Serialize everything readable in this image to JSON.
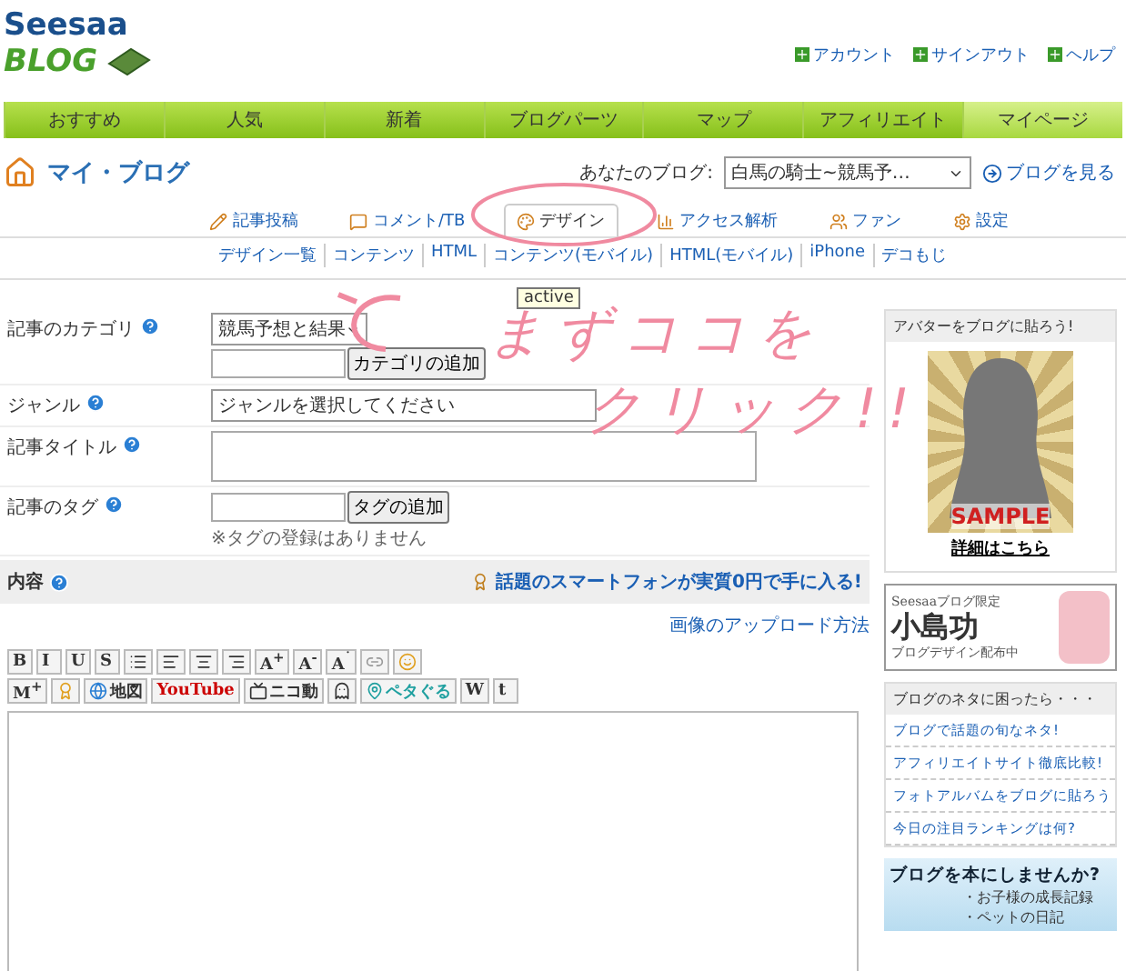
{
  "logo": {
    "line1": "Seesaa",
    "line2": "BLOG"
  },
  "top_links": [
    "アカウント",
    "サインアウト",
    "ヘルプ"
  ],
  "nav": [
    {
      "label": "おすすめ",
      "selected": false
    },
    {
      "label": "人気",
      "selected": false
    },
    {
      "label": "新着",
      "selected": false
    },
    {
      "label": "ブログパーツ",
      "selected": false
    },
    {
      "label": "マップ",
      "selected": false
    },
    {
      "label": "アフィリエイト",
      "selected": false
    },
    {
      "label": "マイページ",
      "selected": true
    }
  ],
  "page_title": "マイ・ブログ",
  "blog_picker": {
    "label": "あなたのブログ:",
    "value": "白馬の騎士~競馬予…",
    "view_link": "ブログを見る"
  },
  "tabs": [
    {
      "label": "記事投稿",
      "selected": false
    },
    {
      "label": "コメント/TB",
      "selected": false
    },
    {
      "label": "デザイン",
      "selected": true
    },
    {
      "label": "アクセス解析",
      "selected": false
    },
    {
      "label": "ファン",
      "selected": false
    },
    {
      "label": "設定",
      "selected": false
    }
  ],
  "subnav": [
    "デザイン一覧",
    "コンテンツ",
    "HTML",
    "コンテンツ(モバイル)",
    "HTML(モバイル)",
    "iPhone",
    "デコもじ"
  ],
  "tooltip": "active",
  "form": {
    "category": {
      "label": "記事のカテゴリ",
      "value": "競馬予想と結果",
      "add_button": "カテゴリの追加"
    },
    "genre": {
      "label": "ジャンル",
      "value": "ジャンルを選択してください"
    },
    "title": {
      "label": "記事タイトル"
    },
    "tags": {
      "label": "記事のタグ",
      "add_button": "タグの追加",
      "note": "※タグの登録はありません"
    },
    "content": {
      "label": "内容",
      "promo": "話題のスマートフォンが実質0円で手に入る!",
      "upload_link": "画像のアップロード方法"
    }
  },
  "toolbar_rows": [
    [
      {
        "kind": "text",
        "label": "B"
      },
      {
        "kind": "text",
        "label": "I"
      },
      {
        "kind": "text",
        "label": "U"
      },
      {
        "kind": "text",
        "label": "S"
      },
      {
        "kind": "list"
      },
      {
        "kind": "align-left"
      },
      {
        "kind": "align-center"
      },
      {
        "kind": "align-right"
      },
      {
        "kind": "text",
        "label": "A$^{+}$"
      },
      {
        "kind": "text",
        "label": "A$^{-}$"
      },
      {
        "kind": "text",
        "label": "A$^{˙}$"
      },
      {
        "kind": "link"
      },
      {
        "kind": "smiley"
      }
    ],
    [
      {
        "kind": "text",
        "label": "M$^{+}$"
      },
      {
        "kind": "award"
      },
      {
        "kind": "globe",
        "label": "地図"
      },
      {
        "kind": "youtube",
        "label": "YouTube"
      },
      {
        "kind": "tv",
        "label": "ニコ動"
      },
      {
        "kind": "ghost"
      },
      {
        "kind": "pin",
        "label": "ペタぐる"
      },
      {
        "kind": "text",
        "label": "W"
      },
      {
        "kind": "text",
        "label": "t"
      }
    ]
  ],
  "sidebar": {
    "avatar": {
      "title": "アバターをブログに貼ろう!",
      "sample": "SAMPLE",
      "link": "詳細はこちら"
    },
    "banner": {
      "line1": "Seesaaブログ限定",
      "line2": "小島功",
      "line3": "ブログデザイン配布中"
    },
    "ideas": {
      "title": "ブログのネタに困ったら・・・",
      "links": [
        "ブログで話題の旬なネタ!",
        "アフィリエイトサイト徹底比較!",
        "フォトアルバムをブログに貼ろう",
        "今日の注目ランキングは何?"
      ]
    },
    "book": {
      "title": "ブログを本にしませんか?",
      "items": [
        "・お子様の成長記録",
        "・ペットの日記"
      ]
    }
  },
  "annotation": {
    "line1": "まずココを",
    "line2": "クリック!!"
  }
}
